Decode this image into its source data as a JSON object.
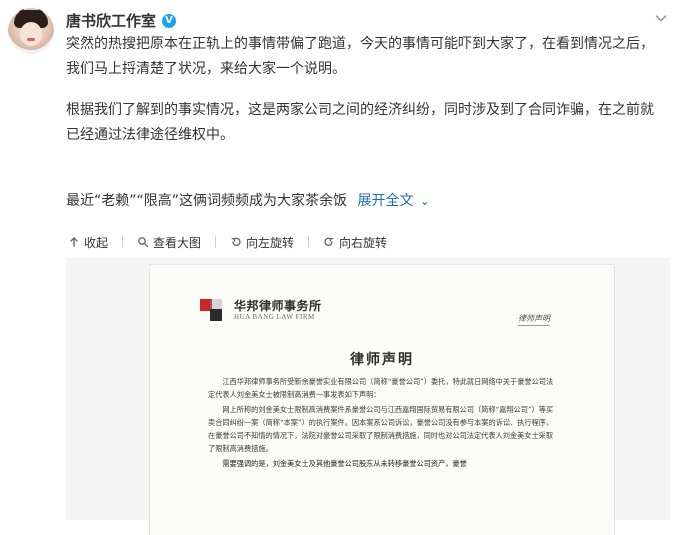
{
  "header": {
    "name": "唐书欣工作室",
    "verified_mark": "V"
  },
  "post": {
    "paragraph1": "突然的热搜把原本在正轨上的事情带偏了跑道，今天的事情可能吓到大家了，在看到情况之后，我们马上捋清楚了状况，来给大家一个说明。",
    "paragraph2": "根据我们了解到的事实情况，这是两家公司之间的经济纠纷，同时涉及到了合同诈骗，在之前就已经通过法律途径维权中。",
    "summary": "最近“老赖”“限高”这俩词频频成为大家茶余饭",
    "expand_label": "展开全文"
  },
  "toolbar": {
    "collapse": "收起",
    "view_large": "查看大图",
    "rotate_left": "向左旋转",
    "rotate_right": "向右旋转"
  },
  "document": {
    "firm_cn": "华邦律师事务所",
    "firm_en": "HUA BANG LAW FIRM",
    "signature": "律师声明",
    "title": "律师声明",
    "para1": "江西华邦律师事务所受新余豪誉实业有限公司（简称“豪誉公司”）委托，特此就日网络中关于豪誉公司法定代表人刘金美女士被限制高消费一事发表如下声明：",
    "para2": "网上所称的刘金美女士限制高消费案件系豪誉公司与江西嘉翔国际贸易有限公司（简称“嘉翔公司”）等买卖合同纠纷一案（简称“本案”）的执行案件。因本案系公司诉讼，豪誉公司没有参与本案的诉讼、执行程序，在豪誉公司不知情的情况下，法院对豪誉公司采取了限制消费措施，同时也对公司法定代表人刘金美女士采取了限制高消费措施。",
    "para3": "需要强调的是，刘金美女士及其他豪誉公司股东从未转移豪誉公司资产，豪誉"
  },
  "colors": {
    "link": "#1e6bb8",
    "verified": "#1da1f2",
    "logo_red": "#c62828",
    "logo_dark": "#2b2b2b"
  },
  "icons": {
    "collapse": "arrow-up-icon",
    "view_large": "magnifier-icon",
    "rotate_left": "rotate-left-icon",
    "rotate_right": "rotate-right-icon",
    "more": "chevron-down-icon"
  }
}
